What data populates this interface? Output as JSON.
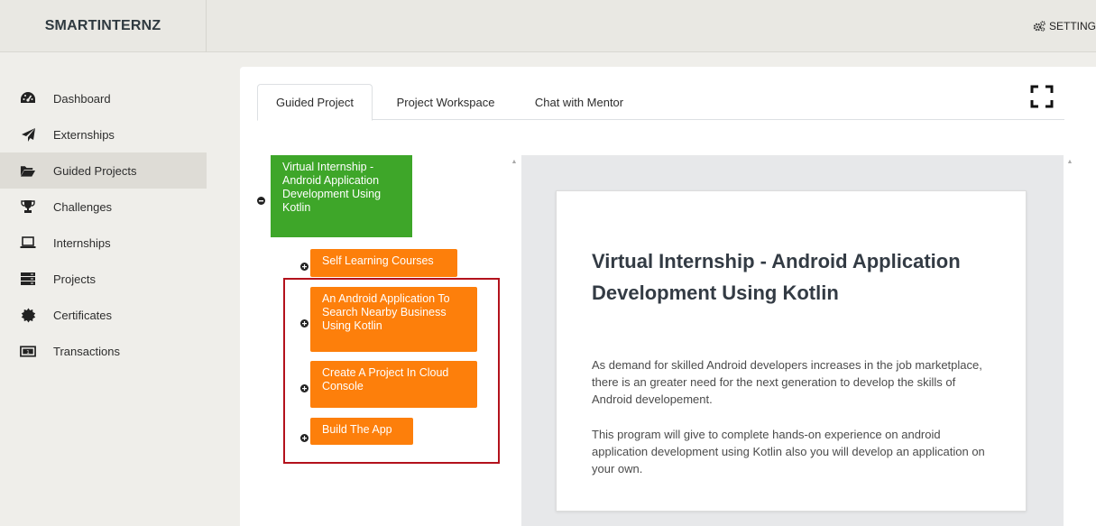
{
  "app": {
    "brand": "SMARTINTERNZ",
    "settings_label": "SETTING"
  },
  "sidebar": {
    "items": [
      {
        "label": "Dashboard",
        "icon": "dashboard-icon"
      },
      {
        "label": "Externships",
        "icon": "paper-plane-icon"
      },
      {
        "label": "Guided Projects",
        "icon": "folder-open-icon",
        "active": true
      },
      {
        "label": "Challenges",
        "icon": "trophy-icon"
      },
      {
        "label": "Internships",
        "icon": "laptop-icon"
      },
      {
        "label": "Projects",
        "icon": "server-icon"
      },
      {
        "label": "Certificates",
        "icon": "certificate-icon"
      },
      {
        "label": "Transactions",
        "icon": "money-icon"
      }
    ]
  },
  "tabs": [
    {
      "label": "Guided Project",
      "active": true
    },
    {
      "label": "Project Workspace"
    },
    {
      "label": "Chat with Mentor"
    }
  ],
  "tree": {
    "root": "Virtual Internship - Android Application Development Using Kotlin",
    "children": [
      "Self Learning Courses",
      "An Android Application To Search Nearby Business Using Kotlin",
      "Create A Project In Cloud Console",
      "Build The App"
    ]
  },
  "content": {
    "title": "Virtual Internship - Android Application Development Using Kotlin",
    "paragraph1": "As demand for skilled Android developers increases in the job marketplace, there is an greater need for the next generation to develop the skills of Android developement.",
    "paragraph2": "This program will give to complete hands-on experience on android application development using Kotlin also you will develop an application on your own."
  },
  "colors": {
    "root_node": "#3ea629",
    "child_node": "#fd7f0b",
    "highlight_border": "#b3121c"
  }
}
